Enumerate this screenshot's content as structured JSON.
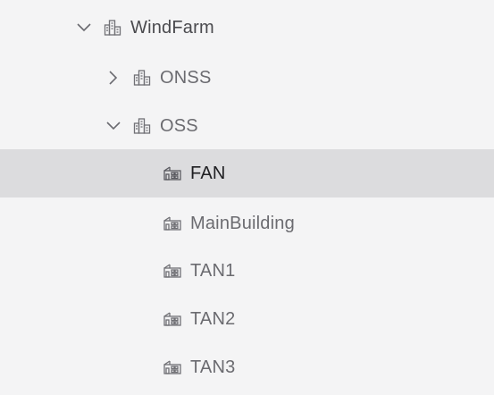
{
  "tree": {
    "root": {
      "label": "WindFarm",
      "expanded": true,
      "icon": "buildings-icon"
    },
    "children": [
      {
        "label": "ONSS",
        "expanded": false,
        "icon": "buildings-icon"
      },
      {
        "label": "OSS",
        "expanded": true,
        "icon": "buildings-icon"
      }
    ],
    "oss_children": [
      {
        "label": "FAN",
        "selected": true,
        "icon": "building-floor-icon"
      },
      {
        "label": "MainBuilding",
        "selected": false,
        "icon": "building-floor-icon"
      },
      {
        "label": "TAN1",
        "selected": false,
        "icon": "building-floor-icon"
      },
      {
        "label": "TAN2",
        "selected": false,
        "icon": "building-floor-icon"
      },
      {
        "label": "TAN3",
        "selected": false,
        "icon": "building-floor-icon"
      }
    ]
  },
  "colors": {
    "background": "#f4f4f5",
    "selected_row": "#dcdcde",
    "text": "#4a4a4e"
  }
}
